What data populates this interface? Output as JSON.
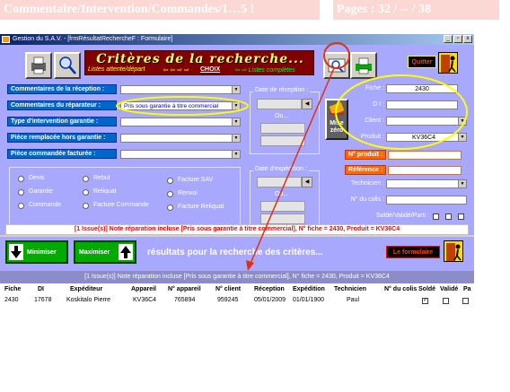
{
  "header": {
    "left_text": "Commentaire/Intervention/Commandes/1…5 !",
    "right_text": "Pages : 32 / -- / 38"
  },
  "window": {
    "title": "Gestion du S.A.V. - [frmRésultatRechercheF : Formulaire]",
    "min_label": "_",
    "max_label": "▫",
    "close_label": "x"
  },
  "banner": {
    "title": "Critères de la recherche...",
    "subtitle_left": "Listes attente/départ",
    "arrows": "⇦ ⇦ ⇨ ⇨",
    "choix": "CHOIX",
    "subtitle_right": "⇦ ⇨ Listes complètes"
  },
  "toolbar": {
    "quitter": "Quitter",
    "mise_zero": "Mise zéro"
  },
  "left_filters": [
    {
      "label": "Commentaires de la réception :",
      "value": ""
    },
    {
      "label": "Commentaires du réparateur :",
      "value": "Pris sous garantie à titre commercial"
    },
    {
      "label": "Type d'intervention garantie :",
      "value": ""
    },
    {
      "label": "Pièce remplacée hors garantie :",
      "value": ""
    },
    {
      "label": "Pièce commandée facturée :",
      "value": ""
    }
  ],
  "dates": {
    "reception_label": "Date de réception :",
    "expedition_label": "Date d'expédition :",
    "ou": "Ou..."
  },
  "radios": {
    "col1": [
      "Devis",
      "Garantie",
      "Commande"
    ],
    "col2": [
      "Rebut",
      "Reliquat",
      "Facture Commande"
    ],
    "col3": [
      "Facture SAV",
      "Renvoi",
      "Facture Reliquat"
    ]
  },
  "right_fields": {
    "fiche_label": "Fiche :",
    "fiche_value": "2430",
    "di_label": "D I :",
    "di_value": "",
    "client_label": "Client :",
    "client_value": "",
    "produit_label": "Produit :",
    "produit_value": "KV36C4",
    "nprod_label": "N° produit :",
    "reference_label": "Référence :",
    "technicien_label": "Technicien :",
    "ncolis_label": "N° du colis :",
    "solde_label": "Soldé/Validé/Parti :"
  },
  "status_line": "[1 Issue(s)]  Note réparation incluse  [Pris sous garantie à titre commercial], N° fiche = 2430, Produit = KV36C4",
  "results": {
    "minimiser": "Minimiser",
    "maximiser": "Maximiser",
    "title": "résultats pour la recherche des critères...",
    "formulaire": "Le formulaire",
    "summary": "[1 Issue(s)]  Note réparation incluse  [Pris sous garantie à titre commercial], N° fiche = 2430, Produit = KV36C4"
  },
  "table": {
    "headers": [
      "Fiche",
      "DI",
      "Expéditeur",
      "Appareil",
      "N° appareil",
      "N° client",
      "Réception",
      "Expédition",
      "Technicien",
      "N° du colis",
      "Soldé",
      "Validé",
      "Pa"
    ],
    "rows": [
      [
        "2430",
        "17678",
        "Koskitalo   Pierre",
        "KV36C4",
        "765894",
        "959245",
        "05/01/2009",
        "01/01/1900",
        "Paul",
        "",
        "checked",
        "",
        ""
      ]
    ]
  },
  "colors": {
    "form_bg": "#a8a8ff",
    "banner_bg": "#800000",
    "highlight_oval": "#ffff00",
    "annotation_red": "#e03010"
  }
}
